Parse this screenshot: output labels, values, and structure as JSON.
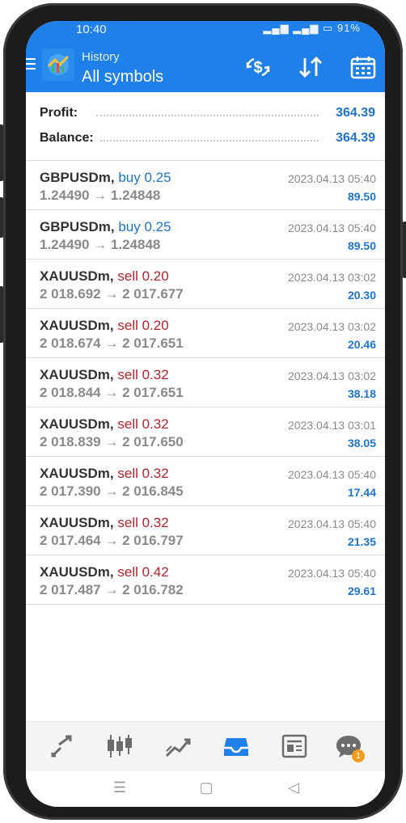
{
  "status_bar": {
    "time": "10:40",
    "battery": "91%"
  },
  "header": {
    "subtitle": "History",
    "title": "All symbols"
  },
  "summary": {
    "profit_label": "Profit:",
    "profit_value": "364.39",
    "balance_label": "Balance:",
    "balance_value": "364.39"
  },
  "deals": [
    {
      "symbol": "GBPUSDm,",
      "side": "buy 0.25",
      "prices": "1.24490 → 1.24848",
      "datetime": "2023.04.13 05:40",
      "profit": "89.50"
    },
    {
      "symbol": "GBPUSDm,",
      "side": "buy 0.25",
      "prices": "1.24490 → 1.24848",
      "datetime": "2023.04.13 05:40",
      "profit": "89.50"
    },
    {
      "symbol": "XAUUSDm,",
      "side": "sell 0.20",
      "prices": "2 018.692 → 2 017.677",
      "datetime": "2023.04.13 03:02",
      "profit": "20.30"
    },
    {
      "symbol": "XAUUSDm,",
      "side": "sell 0.20",
      "prices": "2 018.674 → 2 017.651",
      "datetime": "2023.04.13 03:02",
      "profit": "20.46"
    },
    {
      "symbol": "XAUUSDm,",
      "side": "sell 0.32",
      "prices": "2 018.844 → 2 017.651",
      "datetime": "2023.04.13 03:02",
      "profit": "38.18"
    },
    {
      "symbol": "XAUUSDm,",
      "side": "sell 0.32",
      "prices": "2 018.839 → 2 017.650",
      "datetime": "2023.04.13 03:01",
      "profit": "38.05"
    },
    {
      "symbol": "XAUUSDm,",
      "side": "sell 0.32",
      "prices": "2 017.390 → 2 016.845",
      "datetime": "2023.04.13 05:40",
      "profit": "17.44"
    },
    {
      "symbol": "XAUUSDm,",
      "side": "sell 0.32",
      "prices": "2 017.464 → 2 016.797",
      "datetime": "2023.04.13 05:40",
      "profit": "21.35"
    },
    {
      "symbol": "XAUUSDm,",
      "side": "sell 0.42",
      "prices": "2 017.487 → 2 016.782",
      "datetime": "2023.04.13 05:40",
      "profit": "29.61"
    }
  ],
  "bottom_nav": {
    "items": [
      {
        "icon": "quotes-icon"
      },
      {
        "icon": "chart-icon"
      },
      {
        "icon": "trade-icon"
      },
      {
        "icon": "history-icon",
        "active": true
      },
      {
        "icon": "news-icon"
      },
      {
        "icon": "messages-icon",
        "badge": "1"
      }
    ]
  },
  "system_nav": {
    "recent": "☰",
    "home": "▢",
    "back": "◁"
  },
  "colors": {
    "accent": "#1e80e8",
    "profit": "#1e73d0",
    "buy": "#1e73d0",
    "sell": "#b5232b",
    "badge": "#f59b1a"
  }
}
